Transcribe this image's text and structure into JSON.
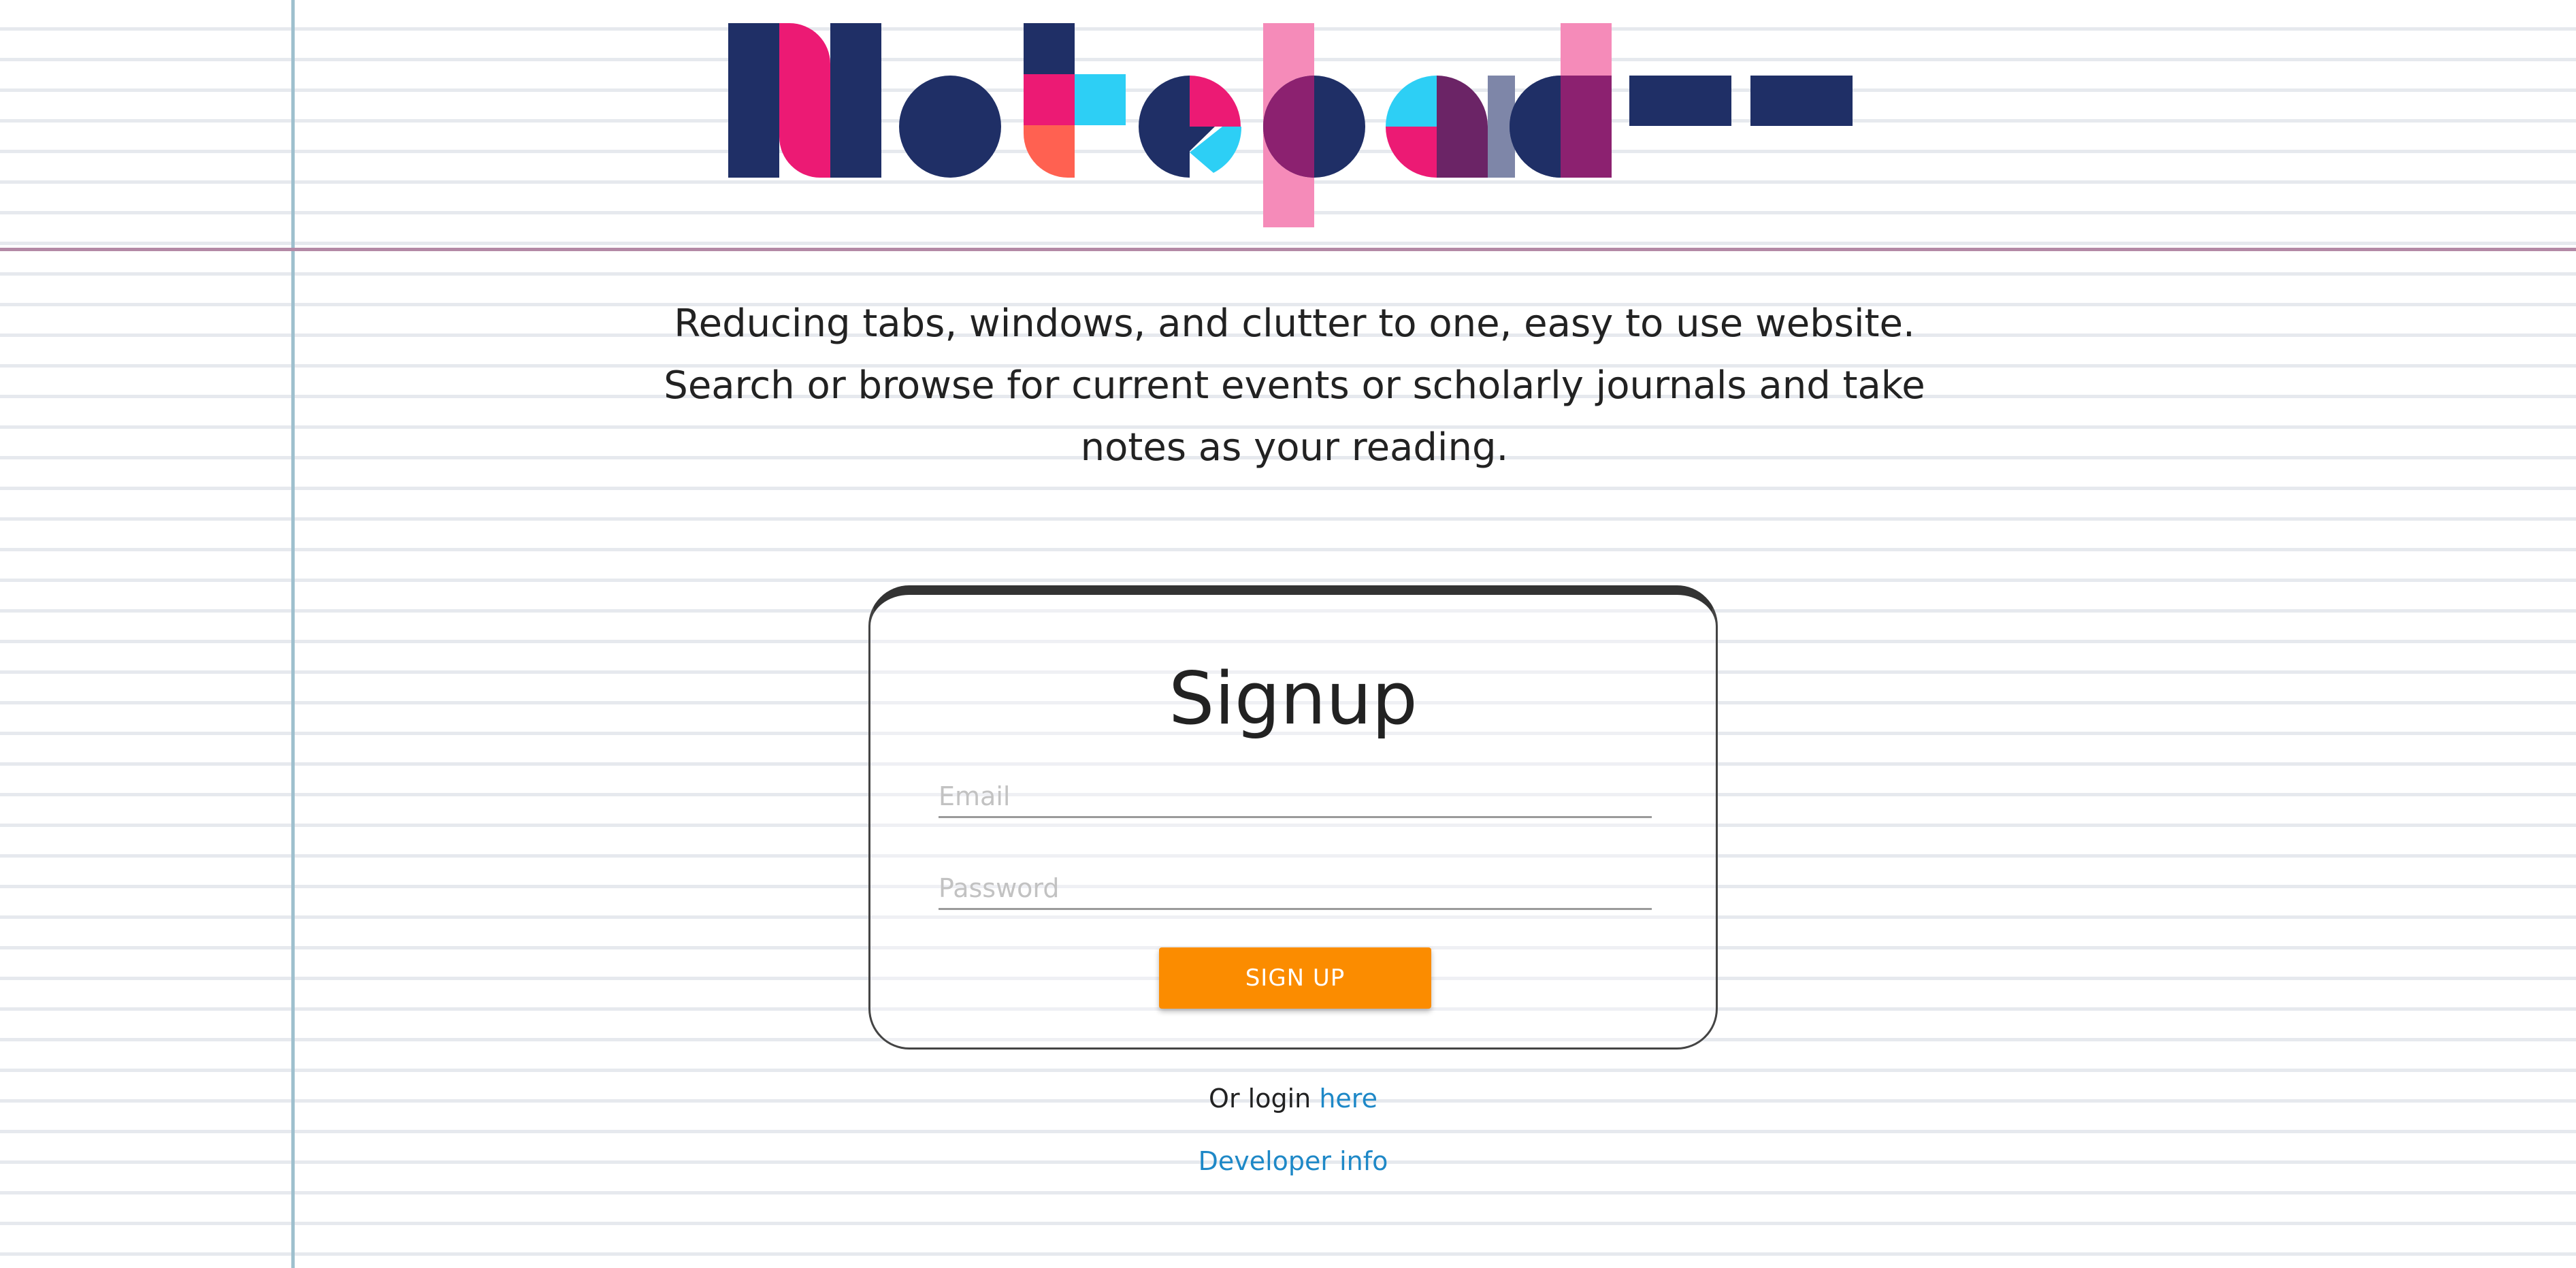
{
  "logo": {
    "text": "Notepad--",
    "colors": {
      "navy": "#1f2f66",
      "pink": "#ec1a74",
      "cyan": "#2dcff5",
      "coral": "#ff6151",
      "light_pink": "#f58bb9",
      "plum": "#8c2170",
      "slate": "#7e86a8",
      "purple_dark": "#6b2466"
    }
  },
  "tagline": {
    "lines": [
      "Reducing tabs, windows, and clutter to one, easy to use website.",
      "Search or browse for current events or scholarly journals and take",
      "notes as your reading."
    ]
  },
  "signup_card": {
    "title": "Signup",
    "email_placeholder": "Email",
    "password_placeholder": "Password",
    "button_label": "SIGN UP"
  },
  "footer": {
    "login_prefix": "Or login",
    "login_link": "here",
    "developer_link": "Developer info"
  },
  "colors": {
    "accent_button": "#fb8c00",
    "link": "#1e88c7",
    "ruled_line": "#e6e9ee",
    "margin_line": "#9fc0ce",
    "header_rule": "#b48aa6"
  }
}
